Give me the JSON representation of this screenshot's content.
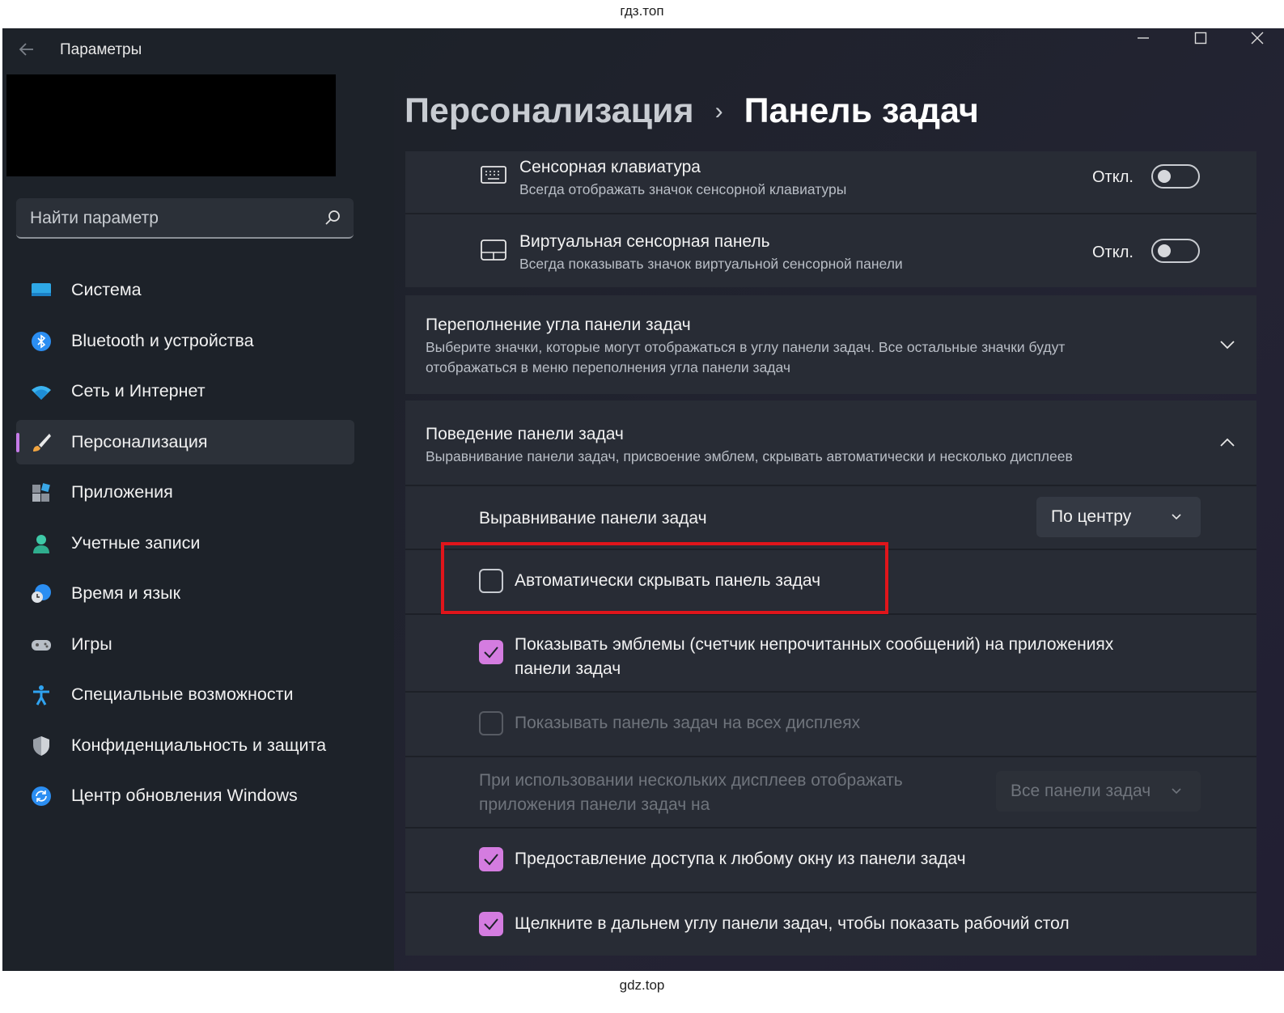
{
  "watermark": {
    "top": "гдз.топ",
    "bottom": "gdz.top"
  },
  "window": {
    "title": "Параметры",
    "controls": [
      "minimize",
      "maximize",
      "close"
    ]
  },
  "search": {
    "placeholder": "Найти параметр",
    "icon": "search-icon"
  },
  "sidebar": {
    "items": [
      {
        "label": "Система",
        "icon": "system-display-icon",
        "active": false
      },
      {
        "label": "Bluetooth и устройства",
        "icon": "bluetooth-icon",
        "active": false
      },
      {
        "label": "Сеть и Интернет",
        "icon": "wifi-icon",
        "active": false
      },
      {
        "label": "Персонализация",
        "icon": "brush-icon",
        "active": true
      },
      {
        "label": "Приложения",
        "icon": "apps-icon",
        "active": false
      },
      {
        "label": "Учетные записи",
        "icon": "account-icon",
        "active": false
      },
      {
        "label": "Время и язык",
        "icon": "time-language-icon",
        "active": false
      },
      {
        "label": "Игры",
        "icon": "gamepad-icon",
        "active": false
      },
      {
        "label": "Специальные возможности",
        "icon": "accessibility-icon",
        "active": false
      },
      {
        "label": "Конфиденциальность и защита",
        "icon": "shield-icon",
        "active": false
      },
      {
        "label": "Центр обновления Windows",
        "icon": "update-icon",
        "active": false
      }
    ]
  },
  "breadcrumb": {
    "parent": "Персонализация",
    "separator": "›",
    "current": "Панель задач"
  },
  "touch_keyboard": {
    "title": "Сенсорная клавиатура",
    "subtitle": "Всегда отображать значок сенсорной клавиатуры",
    "state": "Откл."
  },
  "touchpad": {
    "title": "Виртуальная сенсорная панель",
    "subtitle": "Всегда показывать значок виртуальной сенсорной панели",
    "state": "Откл."
  },
  "overflow": {
    "title": "Переполнение угла панели задач",
    "subtitle_line1": "Выберите значки, которые могут отображаться в углу панели задач. Все остальные значки будут",
    "subtitle_line2": "отображаться в меню переполнения угла панели задач"
  },
  "behavior": {
    "title": "Поведение панели задач",
    "subtitle": "Выравнивание панели задач, присвоение эмблем, скрывать автоматически и несколько дисплеев",
    "alignment": {
      "label": "Выравнивание панели задач",
      "value": "По центру"
    },
    "autohide": {
      "label": "Автоматически скрывать панель задач",
      "checked": false
    },
    "badges": {
      "label_line1": "Показывать эмблемы (счетчик непрочитанных сообщений) на приложениях",
      "label_line2": "панели задач",
      "checked": true
    },
    "all_displays": {
      "label": "Показывать панель задач на всех дисплеях",
      "checked": false,
      "disabled": true
    },
    "multi_display": {
      "label_line1": "При использовании нескольких дисплеев отображать",
      "label_line2": "приложения панели задач на",
      "value": "Все панели задач",
      "disabled": true
    },
    "share_window": {
      "label": "Предоставление доступа к любому окну из панели задач",
      "checked": true
    },
    "show_desktop": {
      "label": "Щелкните в дальнем углу панели задач, чтобы показать рабочий стол",
      "checked": true
    }
  },
  "colors": {
    "accent": "#d47ce0",
    "highlight_box": "#e0151b",
    "window_bg": "#1d2229",
    "card_bg": "#282c35"
  }
}
